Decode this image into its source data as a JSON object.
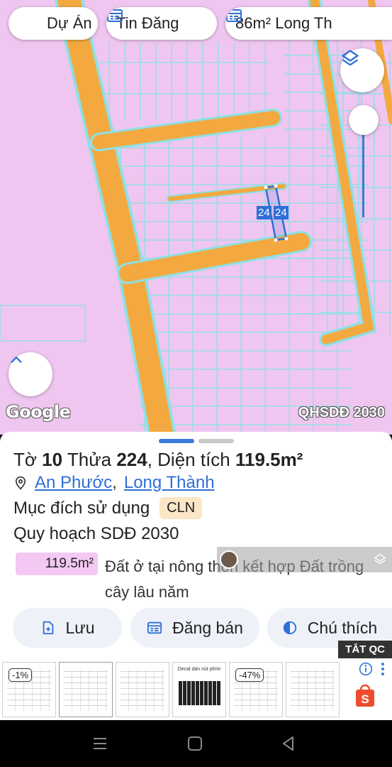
{
  "map": {
    "plot_label": "24",
    "watermark_left": "Google",
    "layer_label": "QHSDĐ 2030",
    "bg_color": "#efc6ef",
    "road_color": "#f3a93f",
    "lot_line_color": "#8fe0e6",
    "highlight_color": "#2f6fd6"
  },
  "chips": {
    "project": "Dự Án",
    "listing": "Tin Đăng",
    "search": "86m² Long Th"
  },
  "panel": {
    "title_sheet_label": "Tờ",
    "title_sheet_num": "10",
    "title_plot_label": "Thửa",
    "title_plot_num": "224",
    "title_area_label": ", Diện tích",
    "title_area_value": "119.5m²",
    "ward": "An Phước",
    "comma": ",",
    "district": "Long Thành",
    "purpose_label": "Mục đích sử dụng",
    "purpose_code": "CLN",
    "plan_label": "Quy hoạch SDĐ 2030",
    "area_chip": "119.5m²",
    "land_desc": "Đất ở tại nông thôn kết hợp Đất trồng cây lâu năm",
    "buttons": {
      "save": "Lưu",
      "post_sale": "Đăng bán",
      "legend": "Chú thích"
    }
  },
  "ads": {
    "close_label": "TẮT QC",
    "discount1": "-1%",
    "discount2": "-47%",
    "kbd_title": "Decal dán nút phím"
  }
}
